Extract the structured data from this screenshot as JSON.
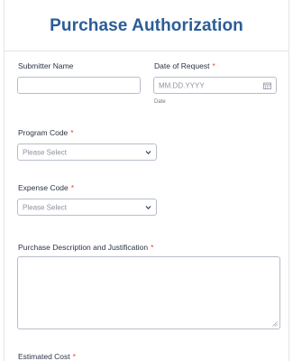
{
  "form": {
    "title": "Purchase Authorization",
    "submitter_name": {
      "label": "Submitter Name",
      "value": ""
    },
    "date_of_request": {
      "label": "Date of Request",
      "required_mark": "*",
      "placeholder": "MM.DD.YYYY",
      "sublabel": "Date",
      "icon": "calendar-icon"
    },
    "program_code": {
      "label": "Program Code",
      "required_mark": "*",
      "selected": "Please Select",
      "icon": "chevron-down-icon"
    },
    "expense_code": {
      "label": "Expense Code",
      "required_mark": "*",
      "selected": "Please Select",
      "icon": "chevron-down-icon"
    },
    "description": {
      "label": "Purchase Description and Justification",
      "required_mark": "*",
      "value": ""
    },
    "estimated_cost": {
      "label": "Estimated Cost",
      "required_mark": "*"
    }
  },
  "colors": {
    "title": "#2a5d98",
    "required": "#f23a3c",
    "border": "#b8bdc9",
    "placeholder": "#8d92a0"
  }
}
